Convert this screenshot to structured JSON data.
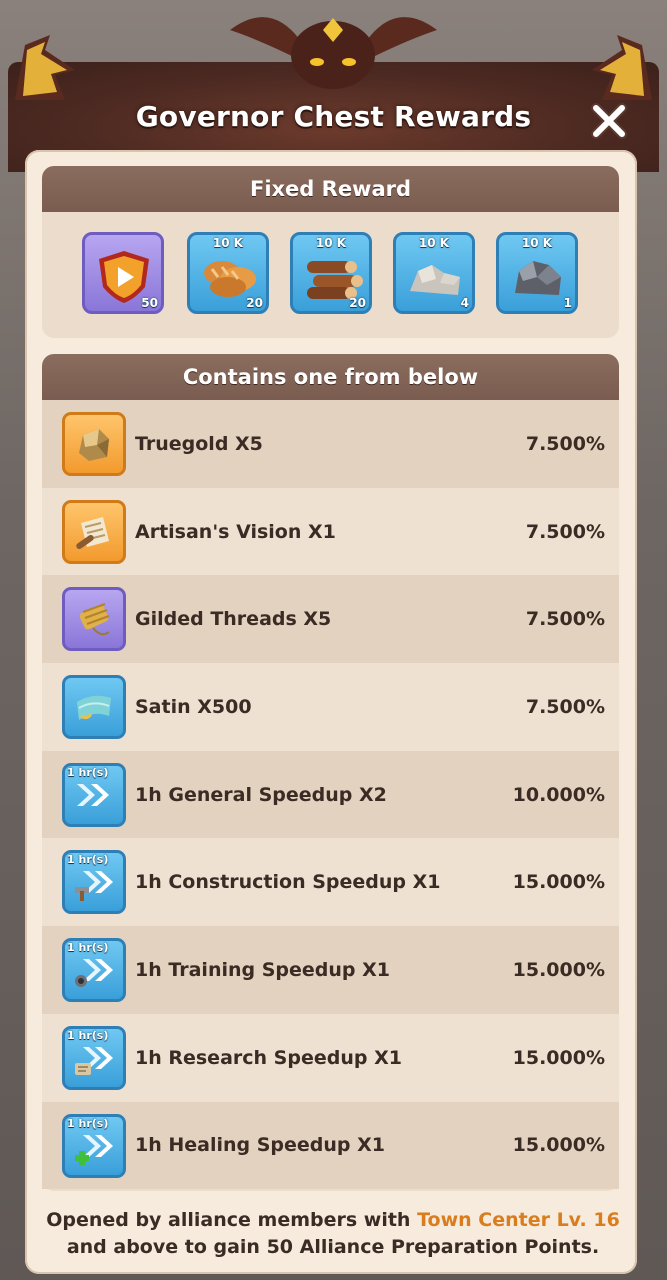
{
  "title": "Governor Chest Rewards",
  "close_icon": "close-x-icon",
  "fixed_reward": {
    "heading": "Fixed Reward",
    "items": [
      {
        "icon": "shield-play-icon",
        "top_label": "",
        "count": "50",
        "tile": "purple"
      },
      {
        "icon": "bread-icon",
        "top_label": "10 K",
        "count": "20",
        "tile": "blue"
      },
      {
        "icon": "wood-logs-icon",
        "top_label": "10 K",
        "count": "20",
        "tile": "blue"
      },
      {
        "icon": "stone-icon",
        "top_label": "10 K",
        "count": "4",
        "tile": "blue"
      },
      {
        "icon": "iron-ore-icon",
        "top_label": "10 K",
        "count": "1",
        "tile": "blue"
      }
    ]
  },
  "contains": {
    "heading": "Contains one from below",
    "rows": [
      {
        "icon": "truegold-icon",
        "badge": "",
        "label": "Truegold X5",
        "pct": "7.500%",
        "tile": "orange"
      },
      {
        "icon": "blueprint-scroll-icon",
        "badge": "",
        "label": "Artisan's Vision X1",
        "pct": "7.500%",
        "tile": "orange"
      },
      {
        "icon": "thread-spool-icon",
        "badge": "",
        "label": "Gilded Threads X5",
        "pct": "7.500%",
        "tile": "purple"
      },
      {
        "icon": "satin-cloth-icon",
        "badge": "",
        "label": "Satin X500",
        "pct": "7.500%",
        "tile": "blue"
      },
      {
        "icon": "speedup-chevrons-icon",
        "badge": "1 hr(s)",
        "label": "1h General Speedup X2",
        "pct": "10.000%",
        "tile": "blue"
      },
      {
        "icon": "construction-speedup-icon",
        "badge": "1 hr(s)",
        "label": "1h Construction Speedup X1",
        "pct": "15.000%",
        "tile": "blue"
      },
      {
        "icon": "training-speedup-icon",
        "badge": "1 hr(s)",
        "label": "1h Training Speedup X1",
        "pct": "15.000%",
        "tile": "blue"
      },
      {
        "icon": "research-speedup-icon",
        "badge": "1 hr(s)",
        "label": "1h Research Speedup X1",
        "pct": "15.000%",
        "tile": "blue"
      },
      {
        "icon": "healing-speedup-icon",
        "badge": "1 hr(s)",
        "label": "1h Healing Speedup X1",
        "pct": "15.000%",
        "tile": "blue"
      }
    ]
  },
  "footer": {
    "part1": "Opened by alliance members with ",
    "highlight": "Town Center Lv. 16",
    "part2": " and above to gain 50 Alliance Preparation Points."
  }
}
